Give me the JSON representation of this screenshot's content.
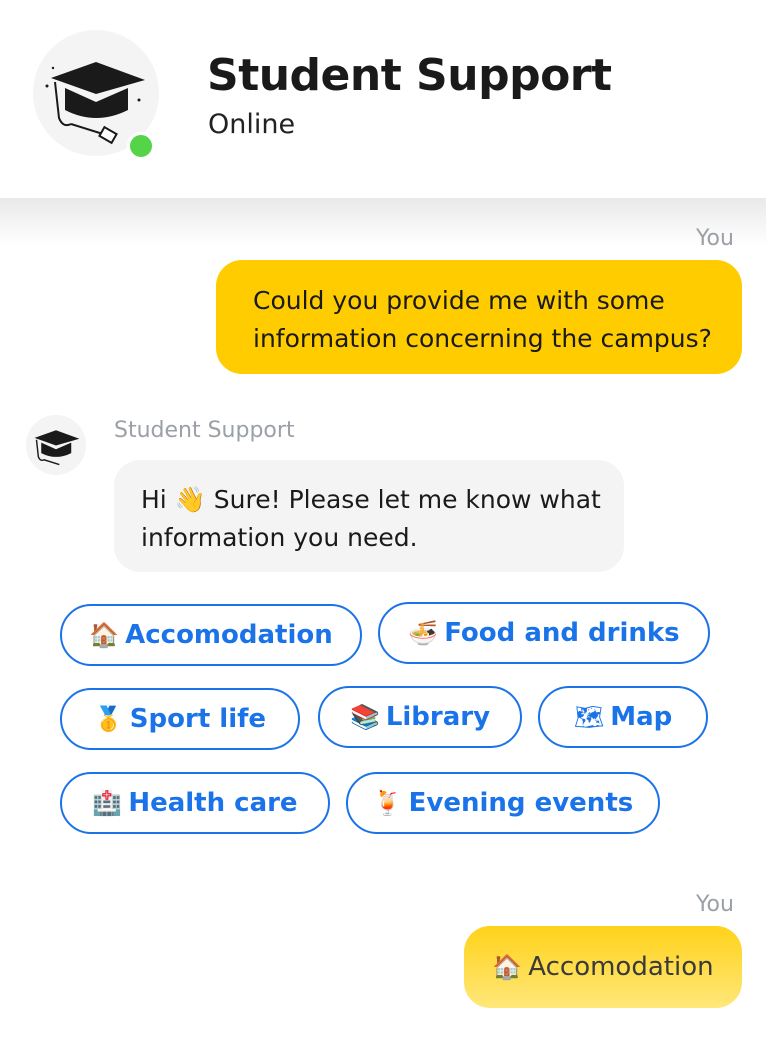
{
  "header": {
    "title": "Student Support",
    "status": "Online"
  },
  "messages": {
    "user_1": {
      "sender": "You",
      "line1": "Could you provide me with some",
      "line2": "information concerning the campus?"
    },
    "bot_1": {
      "sender": "Student Support",
      "greeting": "Hi",
      "wave": "👋",
      "line1_rest": "Sure! Please let me know what",
      "line2": "information you need."
    },
    "user_2": {
      "sender": "You",
      "icon": "🏠",
      "text": "Accomodation"
    }
  },
  "quick_replies": [
    {
      "icon": "🏠",
      "label": "Accomodation"
    },
    {
      "icon": "🍜",
      "label": "Food and drinks"
    },
    {
      "icon": "🥇",
      "label": "Sport life"
    },
    {
      "icon": "📚",
      "label": "Library"
    },
    {
      "icon": "🗺",
      "label": "Map"
    },
    {
      "icon": "🏥",
      "label": "Health care"
    },
    {
      "icon": "🍹",
      "label": "Evening events"
    }
  ],
  "colors": {
    "user_bubble": "#ffcc00",
    "bot_bubble": "#f4f4f4",
    "chip_accent": "#1a73e8",
    "online": "#55d44a"
  },
  "icons": {
    "avatar": "graduation-cap-icon",
    "status": "online-dot-icon"
  }
}
